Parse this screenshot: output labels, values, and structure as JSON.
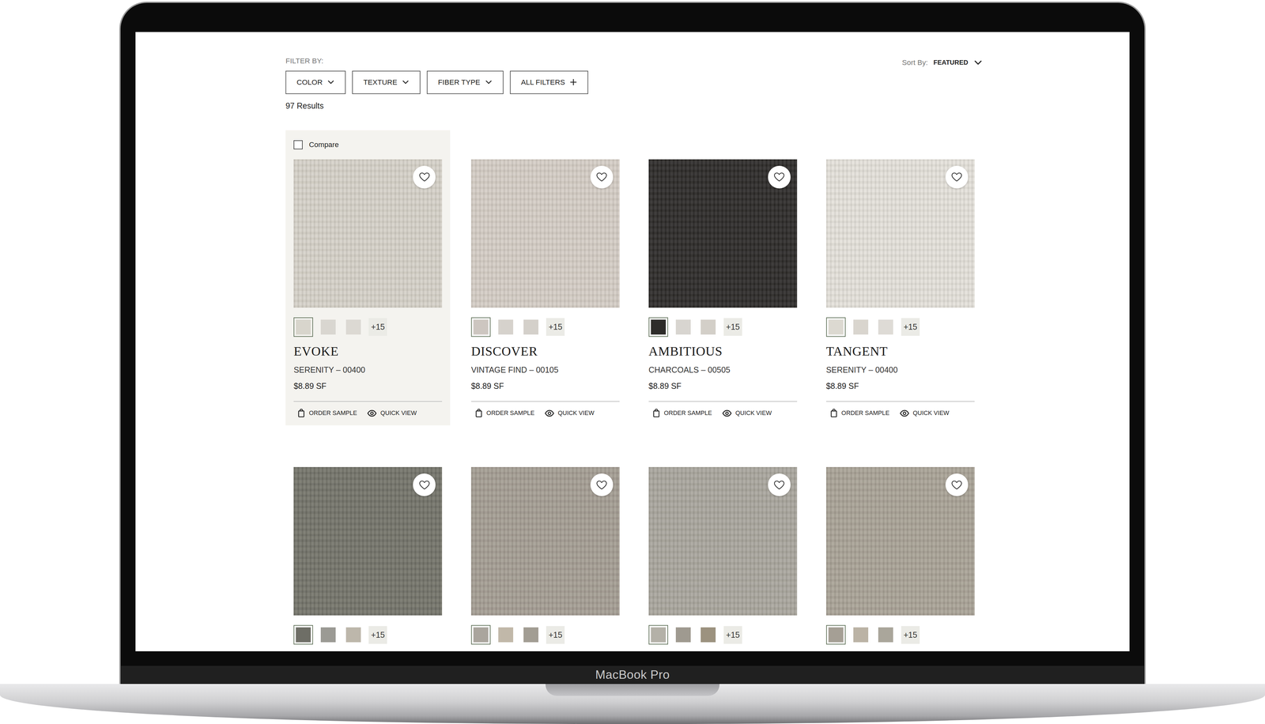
{
  "device": {
    "label": "MacBook Pro"
  },
  "filters": {
    "label": "FILTER BY:",
    "buttons": [
      {
        "label": "COLOR",
        "kind": "dropdown"
      },
      {
        "label": "TEXTURE",
        "kind": "dropdown"
      },
      {
        "label": "FIBER TYPE",
        "kind": "dropdown"
      },
      {
        "label": "ALL FILTERS",
        "kind": "expand"
      }
    ]
  },
  "sort": {
    "label": "Sort By:",
    "value": "FEATURED"
  },
  "results": "97 Results",
  "products": [
    {
      "highlighted": true,
      "compare": {
        "label": "Compare",
        "checked": false
      },
      "favorite": false,
      "color": "#d5d1c8",
      "swatches": [
        {
          "color": "#d8d5cc",
          "selected": true
        },
        {
          "color": "#d9d6d0",
          "selected": false
        },
        {
          "color": "#dcd9d3",
          "selected": false
        }
      ],
      "more": "+15",
      "name": "EVOKE",
      "variant": "SERENITY – 00400",
      "price": "$8.89 SF",
      "actions": [
        {
          "label": "ORDER SAMPLE",
          "kind": "sample"
        },
        {
          "label": "QUICK VIEW",
          "kind": "view"
        }
      ]
    },
    {
      "highlighted": false,
      "favorite": false,
      "color": "#d4cdc5",
      "swatches": [
        {
          "color": "#cdc6c0",
          "selected": true
        },
        {
          "color": "#d6d2cc",
          "selected": false
        },
        {
          "color": "#d4d0ca",
          "selected": false
        }
      ],
      "more": "+15",
      "name": "DISCOVER",
      "variant": "VINTAGE FIND – 00105",
      "price": "$8.89 SF",
      "actions": [
        {
          "label": "ORDER SAMPLE",
          "kind": "sample"
        },
        {
          "label": "QUICK VIEW",
          "kind": "view"
        }
      ]
    },
    {
      "highlighted": false,
      "favorite": false,
      "color": "#2d2b29",
      "swatches": [
        {
          "color": "#2e2c2a",
          "selected": true
        },
        {
          "color": "#d8d5d0",
          "selected": false
        },
        {
          "color": "#d3cfc8",
          "selected": false
        }
      ],
      "more": "+15",
      "name": "AMBITIOUS",
      "variant": "CHARCOALS – 00505",
      "price": "$8.89 SF",
      "actions": [
        {
          "label": "ORDER SAMPLE",
          "kind": "sample"
        },
        {
          "label": "QUICK VIEW",
          "kind": "view"
        }
      ]
    },
    {
      "highlighted": false,
      "favorite": false,
      "color": "#e4e1da",
      "swatches": [
        {
          "color": "#dcd9d1",
          "selected": true
        },
        {
          "color": "#d9d5ce",
          "selected": false
        },
        {
          "color": "#dedbd6",
          "selected": false
        }
      ],
      "more": "+15",
      "name": "TANGENT",
      "variant": "SERENITY – 00400",
      "price": "$8.89 SF",
      "actions": [
        {
          "label": "ORDER SAMPLE",
          "kind": "sample"
        },
        {
          "label": "QUICK VIEW",
          "kind": "view"
        }
      ]
    },
    {
      "highlighted": false,
      "favorite": false,
      "color": "#74746a",
      "swatches": [
        {
          "color": "#6e6e66",
          "selected": true
        },
        {
          "color": "#9b9a94",
          "selected": false
        },
        {
          "color": "#bdb7ab",
          "selected": false
        }
      ],
      "more": "+15"
    },
    {
      "highlighted": false,
      "favorite": false,
      "color": "#a49d93",
      "swatches": [
        {
          "color": "#aaa59d",
          "selected": true
        },
        {
          "color": "#c1b8a9",
          "selected": false
        },
        {
          "color": "#a29d93",
          "selected": false
        }
      ],
      "more": "+15"
    },
    {
      "highlighted": false,
      "favorite": false,
      "color": "#a9a69d",
      "swatches": [
        {
          "color": "#b4b1a8",
          "selected": true
        },
        {
          "color": "#9f9a90",
          "selected": false
        },
        {
          "color": "#9c927f",
          "selected": false
        }
      ],
      "more": "+15"
    },
    {
      "highlighted": false,
      "favorite": false,
      "color": "#a9a296",
      "swatches": [
        {
          "color": "#a59f95",
          "selected": true
        },
        {
          "color": "#bbb3a5",
          "selected": false
        },
        {
          "color": "#aaa69b",
          "selected": false
        }
      ],
      "more": "+15"
    }
  ]
}
